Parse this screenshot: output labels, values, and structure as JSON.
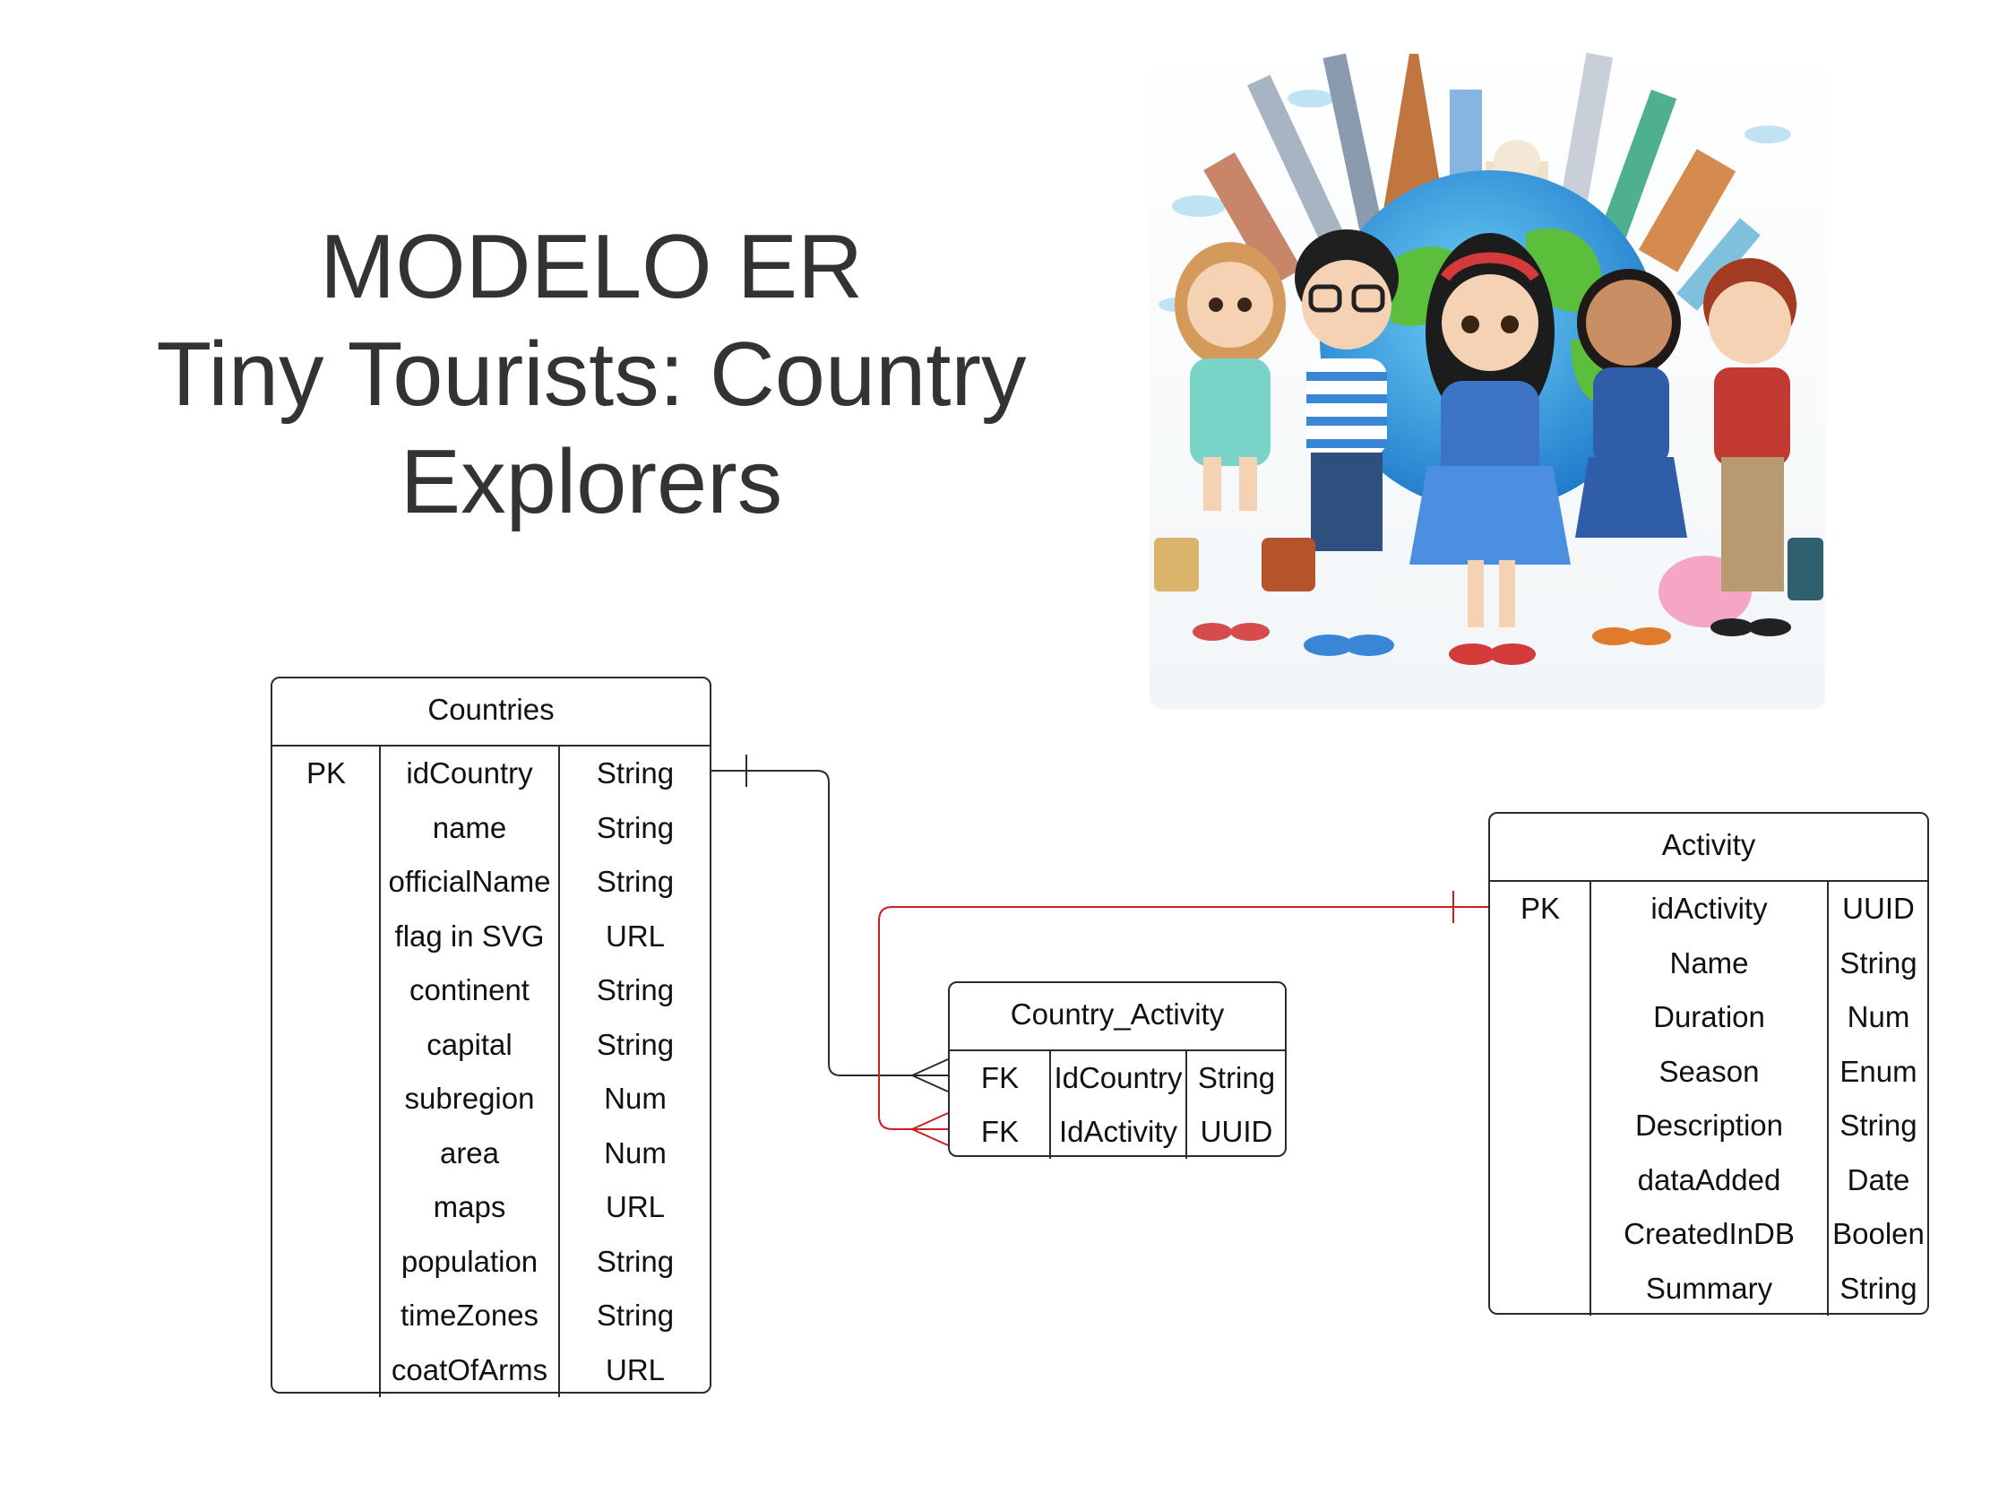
{
  "title": {
    "line1": "MODELO ER",
    "line2": "Tiny Tourists: Country",
    "line3": "Explorers"
  },
  "illustration": {
    "description_icon": "globe-with-children-illustration"
  },
  "colors": {
    "line_black": "#2b2b2b",
    "line_red": "#cc1f1f",
    "title_text": "#333333"
  },
  "tables": {
    "countries": {
      "name": "Countries",
      "rows": [
        {
          "key": "PK",
          "field": "idCountry",
          "type": "String"
        },
        {
          "key": "",
          "field": "name",
          "type": "String"
        },
        {
          "key": "",
          "field": "officialName",
          "type": "String"
        },
        {
          "key": "",
          "field": "flag in SVG",
          "type": "URL"
        },
        {
          "key": "",
          "field": "continent",
          "type": "String"
        },
        {
          "key": "",
          "field": "capital",
          "type": "String"
        },
        {
          "key": "",
          "field": "subregion",
          "type": "Num"
        },
        {
          "key": "",
          "field": "area",
          "type": "Num"
        },
        {
          "key": "",
          "field": "maps",
          "type": "URL"
        },
        {
          "key": "",
          "field": "population",
          "type": "String"
        },
        {
          "key": "",
          "field": "timeZones",
          "type": "String"
        },
        {
          "key": "",
          "field": "coatOfArms",
          "type": "URL"
        }
      ]
    },
    "country_activity": {
      "name": "Country_Activity",
      "rows": [
        {
          "key": "FK",
          "field": "IdCountry",
          "type": "String"
        },
        {
          "key": "FK",
          "field": "IdActivity",
          "type": "UUID"
        }
      ]
    },
    "activity": {
      "name": "Activity",
      "rows": [
        {
          "key": "PK",
          "field": "idActivity",
          "type": "UUID"
        },
        {
          "key": "",
          "field": "Name",
          "type": "String"
        },
        {
          "key": "",
          "field": "Duration",
          "type": "Num"
        },
        {
          "key": "",
          "field": "Season",
          "type": "Enum"
        },
        {
          "key": "",
          "field": "Description",
          "type": "String"
        },
        {
          "key": "",
          "field": "dataAdded",
          "type": "Date"
        },
        {
          "key": "",
          "field": "CreatedInDB",
          "type": "Boolen"
        },
        {
          "key": "",
          "field": "Summary",
          "type": "String"
        }
      ]
    }
  },
  "relationships": [
    {
      "from": "Countries.idCountry",
      "to": "Country_Activity.IdCountry",
      "from_end": "one",
      "to_end": "many",
      "color": "#2b2b2b"
    },
    {
      "from": "Activity.idActivity",
      "to": "Country_Activity.IdActivity",
      "from_end": "one",
      "to_end": "many",
      "color": "#cc1f1f"
    }
  ]
}
